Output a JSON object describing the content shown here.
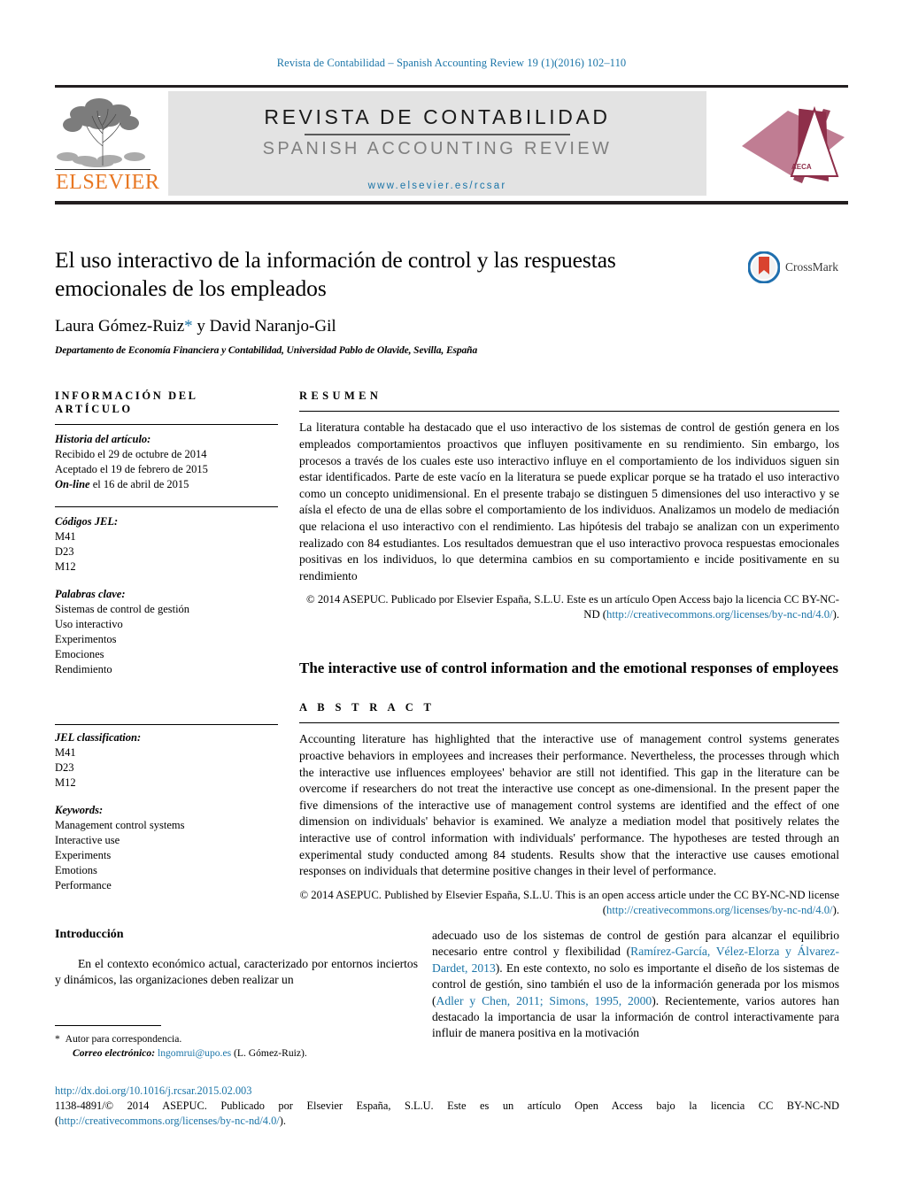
{
  "running_head": "Revista de Contabilidad – Spanish Accounting Review 19 (1)(2016) 102–110",
  "masthead": {
    "publisher_name": "ELSEVIER",
    "journal_title": "REVISTA DE CONTABILIDAD",
    "journal_subtitle": "SPANISH ACCOUNTING REVIEW",
    "journal_url": "www.elsevier.es/rcsar",
    "society_logo_label": "AECA"
  },
  "article": {
    "title": "El uso interactivo de la información de control y las respuestas emocionales de los empleados",
    "authors": "Laura Gómez-Ruiz",
    "authors_star": "*",
    "authors_rest": " y David Naranjo-Gil",
    "affiliation": "Departamento de Economía Financiera y Contabilidad, Universidad Pablo de Olavide, Sevilla, España",
    "crossmark_label": "CrossMark"
  },
  "info_panel": {
    "heading": "INFORMACIÓN DEL ARTÍCULO",
    "history_label": "Historia del artículo:",
    "history": [
      "Recibido el 29 de octubre de 2014",
      "Aceptado el 19 de febrero de 2015"
    ],
    "online_prefix": "On-line",
    "online_rest": " el 16 de abril de 2015",
    "jel_label_es": "Códigos JEL:",
    "jel_codes_es": [
      "M41",
      "D23",
      "M12"
    ],
    "keywords_label_es": "Palabras clave:",
    "keywords_es": [
      "Sistemas de control de gestión",
      "Uso interactivo",
      "Experimentos",
      "Emociones",
      "Rendimiento"
    ],
    "jel_label_en": "JEL classification:",
    "jel_codes_en": [
      "M41",
      "D23",
      "M12"
    ],
    "keywords_label_en": "Keywords:",
    "keywords_en": [
      "Management control systems",
      "Interactive use",
      "Experiments",
      "Emotions",
      "Performance"
    ]
  },
  "resumen": {
    "heading": "RESUMEN",
    "text": "La literatura contable ha destacado que el uso interactivo de los sistemas de control de gestión genera en los empleados comportamientos proactivos que influyen positivamente en su rendimiento. Sin embargo, los procesos a través de los cuales este uso interactivo influye en el comportamiento de los individuos siguen sin estar identificados. Parte de este vacío en la literatura se puede explicar porque se ha tratado el uso interactivo como un concepto unidimensional. En el presente trabajo se distinguen 5 dimensiones del uso interactivo y se aísla el efecto de una de ellas sobre el comportamiento de los individuos. Analizamos un modelo de mediación que relaciona el uso interactivo con el rendimiento. Las hipótesis del trabajo se analizan con un experimento realizado con 84 estudiantes. Los resultados demuestran que el uso interactivo provoca respuestas emocionales positivas en los individuos, lo que determina cambios en su comportamiento e incide positivamente en su rendimiento",
    "copyright_pre": "© 2014 ASEPUC. Publicado por Elsevier España, S.L.U. Este es un artículo Open Access bajo la licencia CC BY-NC-ND (",
    "copyright_link": "http://creativecommons.org/licenses/by-nc-nd/4.0/",
    "copyright_post": ")."
  },
  "abstract": {
    "en_title": "The interactive use of control information and the emotional responses of employees",
    "heading": "A B S T R A C T",
    "text": "Accounting literature has highlighted that the interactive use of management control systems generates proactive behaviors in employees and increases their performance. Nevertheless, the processes through which the interactive use influences employees' behavior are still not identified. This gap in the literature can be overcome if researchers do not treat the interactive use concept as one-dimensional. In the present paper the five dimensions of the interactive use of management control systems are identified and the effect of one dimension on individuals' behavior is examined. We analyze a mediation model that positively relates the interactive use of control information with individuals' performance. The hypotheses are tested through an experimental study conducted among 84 students. Results show that the interactive use causes emotional responses on individuals that determine positive changes in their level of performance.",
    "copyright_pre": "© 2014 ASEPUC. Published by Elsevier España, S.L.U. This is an open access article under the CC BY-NC-ND license (",
    "copyright_link": "http://creativecommons.org/licenses/by-nc-nd/4.0/",
    "copyright_post": ")."
  },
  "body": {
    "intro_heading": "Introducción",
    "left_paragraph": "En el contexto económico actual, caracterizado por entornos inciertos y dinámicos, las organizaciones deben realizar un",
    "right_p1": "adecuado uso de los sistemas de control de gestión para alcanzar el equilibrio necesario entre control y flexibilidad (",
    "right_cite1": "Ramírez-García, Vélez-Elorza y Álvarez-Dardet, 2013",
    "right_p2": "). En este contexto, no solo es importante el diseño de los sistemas de control de gestión, sino también el uso de la información generada por los mismos (",
    "right_cite2": "Adler y Chen, 2011; Simons, 1995, 2000",
    "right_p3": "). Recientemente, varios autores han destacado la importancia de usar la información de control interactivamente para influir de manera positiva en la motivación"
  },
  "footnote": {
    "marker": "*",
    "corresponding": "Autor para correspondencia.",
    "email_label": "Correo electrónico:",
    "email": "lngomrui@upo.es",
    "email_owner": "(L. Gómez-Ruiz)."
  },
  "footer": {
    "doi": "http://dx.doi.org/10.1016/j.rcsar.2015.02.003",
    "issn_line": "1138-4891/© 2014 ASEPUC. Publicado por Elsevier España, S.L.U. Este es un artículo Open Access bajo la licencia CC BY-NC-ND",
    "issn_link_open": "(",
    "issn_link": "http://creativecommons.org/licenses/by-nc-nd/4.0/",
    "issn_link_close": ")."
  },
  "colors": {
    "link_blue": "#1b75a8",
    "elsevier_orange": "#e87722",
    "aeca_maroon": "#8e2f4a",
    "banner_grey": "#e3e3e3"
  }
}
